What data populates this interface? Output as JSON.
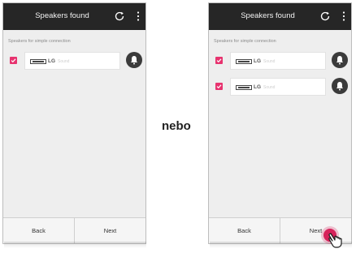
{
  "separator": "nebo",
  "screens": [
    {
      "title": "Speakers found",
      "section_label": "Speakers for simple connection",
      "speakers": [
        {
          "brand": "LG",
          "name": "Sound",
          "checked": true
        }
      ],
      "back_label": "Back",
      "next_label": "Next"
    },
    {
      "title": "Speakers found",
      "section_label": "Speakers for simple connection",
      "speakers": [
        {
          "brand": "LG",
          "name": "Sound",
          "checked": true
        },
        {
          "brand": "LG",
          "name": "Sound",
          "checked": true
        }
      ],
      "back_label": "Back",
      "next_label": "Next"
    }
  ],
  "icons": {
    "refresh": "refresh-icon",
    "more": "more-vertical-icon",
    "bell": "bell-icon",
    "check": "checkbox-checked-icon",
    "hand": "hand-pointer-icon"
  },
  "colors": {
    "topbar": "#262626",
    "accent": "#e7336f",
    "background": "#eeeeee"
  }
}
